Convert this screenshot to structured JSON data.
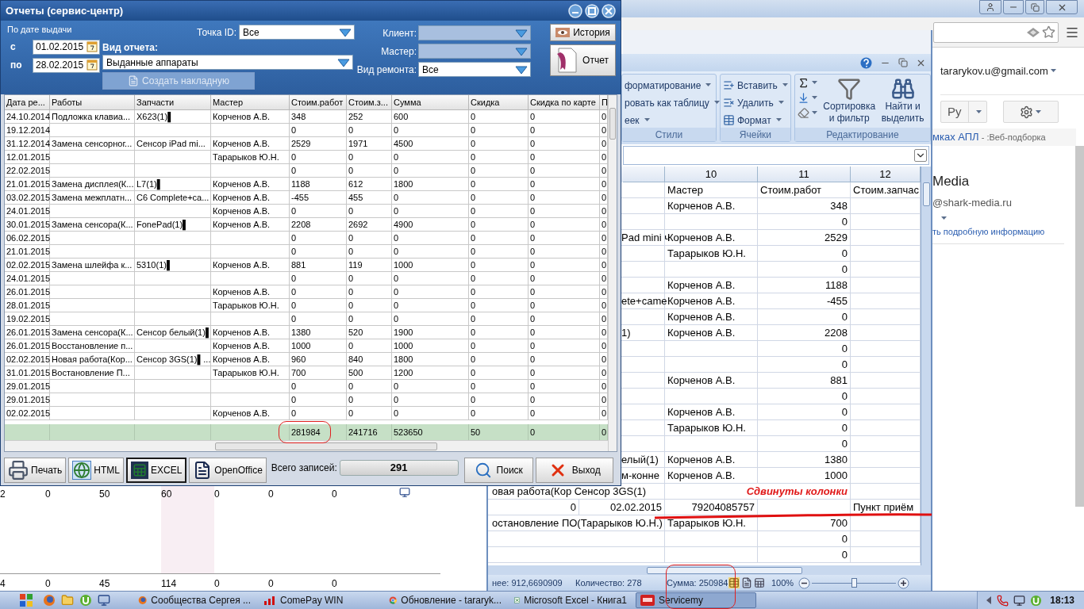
{
  "chrome": {
    "account": "tararykov.u@gmail.com",
    "lang_button": "Ру",
    "snippet_link": "мках АПЛ",
    "snippet_text": "- :Веб-подборка",
    "name": "Media",
    "email": "@shark-media.ru",
    "details_link": "ть подробную информацию"
  },
  "background_sheet": {
    "rows": [
      [
        "2",
        "0",
        "50",
        "60",
        "0",
        "0",
        "0"
      ],
      [
        "4",
        "0",
        "45",
        "114",
        "0",
        "0",
        "0"
      ]
    ]
  },
  "excel": {
    "ribbon": [
      {
        "label": "Стили",
        "items": [
          "форматирование",
          "ровать как таблицу",
          "еек"
        ]
      },
      {
        "label": "Ячейки",
        "items": [
          "Вставить",
          "Удалить",
          "Формат"
        ]
      },
      {
        "label": "Редактирование",
        "items": [
          "Сортировка и фильтр",
          "Найти и выделить"
        ]
      }
    ],
    "column_headers": [
      "10",
      "11",
      "12"
    ],
    "rows": [
      {
        "kind": "header",
        "master": "Мастер",
        "cost": "Стоим.работ",
        "column_12": "Стоим.запчас"
      },
      {
        "kind": "plain",
        "master": "Корченов А.В.",
        "cost": "348"
      },
      {
        "kind": "plain",
        "cost": "0"
      },
      {
        "kind": "plain",
        "overflow": "Pad mini ч",
        "master": "Корченов А.В.",
        "cost": "2529"
      },
      {
        "kind": "plain",
        "master": "Тарарыков Ю.Н.",
        "cost": "0"
      },
      {
        "kind": "plain",
        "cost": "0"
      },
      {
        "kind": "plain",
        "master": "Корченов А.В.",
        "cost": "1188"
      },
      {
        "kind": "plain",
        "overflow": "ete+came",
        "master": "Корченов А.В.",
        "cost": "-455"
      },
      {
        "kind": "plain",
        "master": "Корченов А.В.",
        "cost": "0"
      },
      {
        "kind": "plain",
        "overflow": "1)",
        "master": "Корченов А.В.",
        "cost": "2208"
      },
      {
        "kind": "plain",
        "cost": "0"
      },
      {
        "kind": "plain",
        "cost": "0"
      },
      {
        "kind": "plain",
        "master": "Корченов А.В.",
        "cost": "881"
      },
      {
        "kind": "plain",
        "cost": "0"
      },
      {
        "kind": "plain",
        "master": "Корченов А.В.",
        "cost": "0"
      },
      {
        "kind": "plain",
        "master": "Тарарыков Ю.Н.",
        "cost": "0"
      },
      {
        "kind": "plain",
        "cost": "0"
      },
      {
        "kind": "plain",
        "overflow": "елый(1)",
        "master": "Корченов А.В.",
        "cost": "1380"
      },
      {
        "kind": "plain",
        "overflow": "м-конне",
        "master": "Корченов А.В.",
        "cost": "1000"
      },
      {
        "kind": "wide",
        "overflow": "овая работа(Кор Сенсор 3GS(1)",
        "note": "Сдвинуты колонки"
      },
      {
        "kind": "shifted",
        "cells": [
          "0",
          "02.02.2015",
          "79204085757",
          "Пункт приём"
        ]
      },
      {
        "kind": "wide",
        "overflow": "остановление ПО(Тарарыков Ю.Н.)",
        "master": "Тарарыков Ю.Н.",
        "cost": "700"
      },
      {
        "kind": "plain",
        "cost": "0"
      },
      {
        "kind": "plain",
        "cost": "0"
      }
    ],
    "status": {
      "average": "нее: 912,6690909",
      "count": "Количество: 278",
      "sum": "Сумма: 250984",
      "sum_circled": true,
      "zoom": "100%",
      "level": 0.5
    }
  },
  "dialog": {
    "title": "Отчеты (сервис-центр)",
    "filters": {
      "date_group": "По дате выдачи",
      "from_label": "с",
      "from": "01.02.2015",
      "to_label": "по",
      "to": "28.02.2015",
      "point_label": "Точка ID:",
      "point": "Все",
      "report_type_label": "Вид отчета:",
      "report_type": "Выданные аппараты",
      "invoice_button": {
        "label": "Создать накладную",
        "disabled": true
      },
      "right_fields": [
        {
          "label": "Клиент:",
          "disabled": true
        },
        {
          "label": "Мастер:",
          "disabled": true
        },
        {
          "label": "Вид ремонта:",
          "value": "Все",
          "disabled": false
        }
      ]
    },
    "history_button": "История",
    "report_button": "Отчет",
    "table": {
      "columns": [
        "Дата ре...",
        "Работы",
        "Запчасти",
        "Мастер",
        "Стоим.работ",
        "Стоим.з...",
        "Сумма",
        "Скидка",
        "Скидка по карте",
        "П"
      ],
      "rows": [
        {
          "date": "24.10.2014",
          "work": "Подложка клавиа...",
          "parts": "X623(1)▌",
          "master": "Корченов А.В.",
          "cost_work": "348",
          "cost_parts": "252",
          "sum": "600",
          "discount": "0",
          "card_discount": "0",
          "column_10": "0"
        },
        {
          "date": "19.12.2014",
          "cost_work": "0",
          "cost_parts": "0",
          "sum": "0",
          "discount": "0",
          "card_discount": "0",
          "column_10": "0"
        },
        {
          "date": "31.12.2014",
          "work": "Замена сенсорног...",
          "parts": "Сенсор iPad mi...",
          "master": "Корченов А.В.",
          "cost_work": "2529",
          "cost_parts": "1971",
          "sum": "4500",
          "discount": "0",
          "card_discount": "0",
          "column_10": "0"
        },
        {
          "date": "12.01.2015",
          "master": "Тарарыков Ю.Н.",
          "cost_work": "0",
          "cost_parts": "0",
          "sum": "0",
          "discount": "0",
          "card_discount": "0",
          "column_10": "0"
        },
        {
          "date": "22.02.2015",
          "cost_work": "0",
          "cost_parts": "0",
          "sum": "0",
          "discount": "0",
          "card_discount": "0",
          "column_10": "0"
        },
        {
          "date": "21.01.2015",
          "work": "Замена дисплея(К...",
          "parts": "L7(1)▌",
          "master": "Корченов А.В.",
          "cost_work": "1188",
          "cost_parts": "612",
          "sum": "1800",
          "discount": "0",
          "card_discount": "0",
          "column_10": "0"
        },
        {
          "date": "03.02.2015",
          "work": "Замена межплатн...",
          "parts": "C6 Complete+ca...",
          "master": "Корченов А.В.",
          "cost_work": "-455",
          "cost_parts": "455",
          "sum": "0",
          "discount": "0",
          "card_discount": "0",
          "column_10": "0"
        },
        {
          "date": "24.01.2015",
          "master": "Корченов А.В.",
          "cost_work": "0",
          "cost_parts": "0",
          "sum": "0",
          "discount": "0",
          "card_discount": "0",
          "column_10": "0"
        },
        {
          "date": "30.01.2015",
          "work": "Замена сенсора(К...",
          "parts": "FonePad(1)▌",
          "master": "Корченов А.В.",
          "cost_work": "2208",
          "cost_parts": "2692",
          "sum": "4900",
          "discount": "0",
          "card_discount": "0",
          "column_10": "0"
        },
        {
          "date": "06.02.2015",
          "cost_work": "0",
          "cost_parts": "0",
          "sum": "0",
          "discount": "0",
          "card_discount": "0",
          "column_10": "0"
        },
        {
          "date": "21.01.2015",
          "cost_work": "0",
          "cost_parts": "0",
          "sum": "0",
          "discount": "0",
          "card_discount": "0",
          "column_10": "0"
        },
        {
          "date": "02.02.2015",
          "work": "Замена шлейфа к...",
          "parts": "5310(1)▌",
          "master": "Корченов А.В.",
          "cost_work": "881",
          "cost_parts": "119",
          "sum": "1000",
          "discount": "0",
          "card_discount": "0",
          "column_10": "0"
        },
        {
          "date": "24.01.2015",
          "cost_work": "0",
          "cost_parts": "0",
          "sum": "0",
          "discount": "0",
          "card_discount": "0",
          "column_10": "0"
        },
        {
          "date": "26.01.2015",
          "master": "Корченов А.В.",
          "cost_work": "0",
          "cost_parts": "0",
          "sum": "0",
          "discount": "0",
          "card_discount": "0",
          "column_10": "0"
        },
        {
          "date": "28.01.2015",
          "master": "Тарарыков Ю.Н.",
          "cost_work": "0",
          "cost_parts": "0",
          "sum": "0",
          "discount": "0",
          "card_discount": "0",
          "column_10": "0"
        },
        {
          "date": "19.02.2015",
          "cost_work": "0",
          "cost_parts": "0",
          "sum": "0",
          "discount": "0",
          "card_discount": "0",
          "column_10": "0"
        },
        {
          "date": "26.01.2015",
          "work": "Замена сенсора(К...",
          "parts": "Сенсор белый(1)▌",
          "master": "Корченов А.В.",
          "cost_work": "1380",
          "cost_parts": "520",
          "sum": "1900",
          "discount": "0",
          "card_discount": "0",
          "column_10": "0"
        },
        {
          "date": "26.01.2015",
          "work": "Восстановление п...",
          "master": "Корченов А.В.",
          "cost_work": "1000",
          "cost_parts": "0",
          "sum": "1000",
          "discount": "0",
          "card_discount": "0",
          "column_10": "0"
        },
        {
          "date": "02.02.2015",
          "work": "Новая работа(Кор...",
          "parts": "Сенсор 3GS(1)▌...",
          "master": "Корченов А.В.",
          "cost_work": "960",
          "cost_parts": "840",
          "sum": "1800",
          "discount": "0",
          "card_discount": "0",
          "column_10": "0"
        },
        {
          "date": "31.01.2015",
          "work": "Востановление П...",
          "master": "Тарарыков Ю.Н.",
          "cost_work": "700",
          "cost_parts": "500",
          "sum": "1200",
          "discount": "0",
          "card_discount": "0",
          "column_10": "0"
        },
        {
          "date": "29.01.2015",
          "cost_work": "0",
          "cost_parts": "0",
          "sum": "0",
          "discount": "0",
          "card_discount": "0",
          "column_10": "0"
        },
        {
          "date": "29.01.2015",
          "cost_work": "0",
          "cost_parts": "0",
          "sum": "0",
          "discount": "0",
          "card_discount": "0",
          "column_10": "0"
        },
        {
          "date": "02.02.2015",
          "master": "Корченов А.В.",
          "cost_work": "0",
          "cost_parts": "0",
          "sum": "0",
          "discount": "0",
          "card_discount": "0",
          "column_10": "0"
        }
      ],
      "totals": [
        {
          "value": "281984",
          "circled": true
        },
        {
          "value": "241716"
        },
        {
          "value": "523650"
        },
        {
          "value": "50"
        },
        {
          "value": "0"
        },
        {
          "value": "0"
        }
      ]
    },
    "toolbar": {
      "buttons": [
        {
          "kind": "print",
          "label": "Печать",
          "selected": false
        },
        {
          "kind": "html",
          "label": "HTML",
          "selected": false
        },
        {
          "kind": "excel",
          "label": "EXCEL",
          "selected": true
        },
        {
          "kind": "openoffice",
          "label": "OpenOffice",
          "selected": false
        }
      ],
      "total_label": "Всего записей:",
      "total": "291",
      "search_button": "Поиск",
      "exit_button": "Выход"
    }
  },
  "taskbar": {
    "tasks": [
      {
        "kind": "firefox",
        "label": "Сообщества Сергея ...",
        "selected": false
      },
      {
        "kind": "comepay",
        "label": "ComePay WIN",
        "selected": false
      },
      {
        "kind": "chrome",
        "label": "Обновление - tararyk...",
        "selected": false
      },
      {
        "kind": "excel",
        "label": "Microsoft Excel - Книга1",
        "selected": false
      },
      {
        "kind": "servicemy",
        "label": "Servicemy",
        "selected": true
      }
    ],
    "clock": "18:13"
  }
}
